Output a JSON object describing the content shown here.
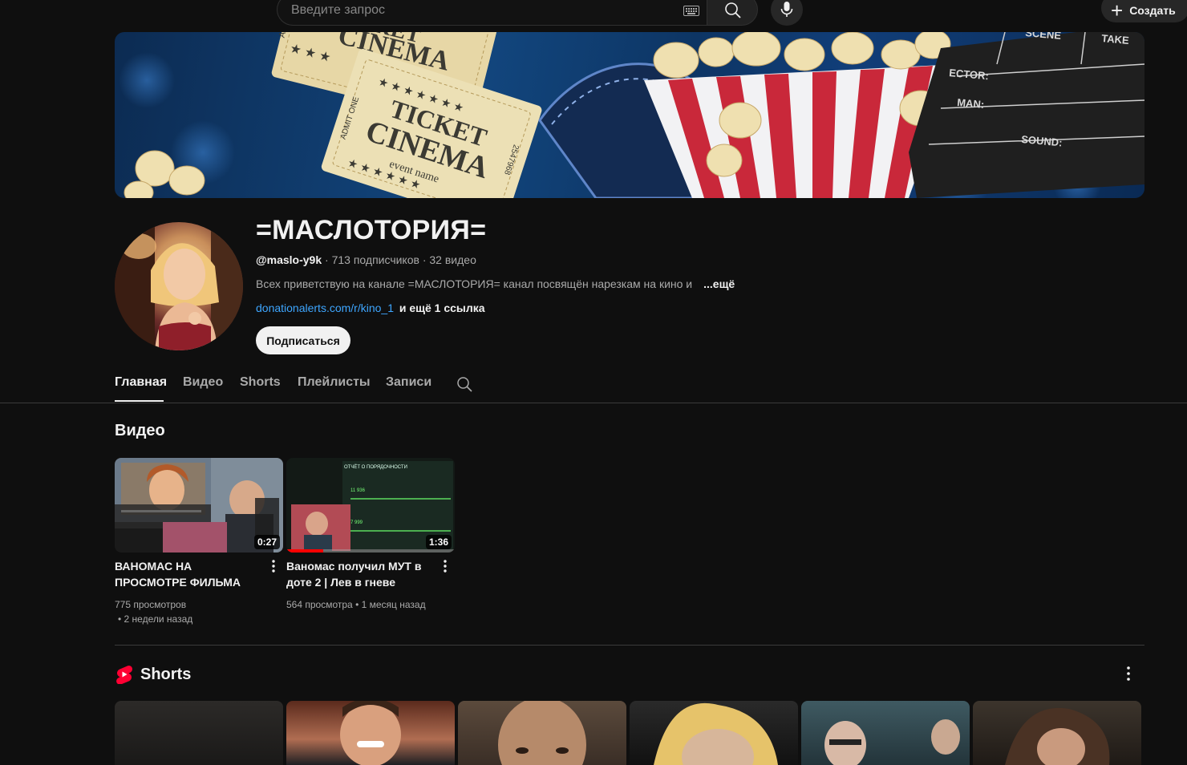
{
  "search": {
    "placeholder": "Введите запрос"
  },
  "header": {
    "create_label": "Создать"
  },
  "channel": {
    "name": "=МАСЛОТОРИЯ=",
    "handle": "@maslo-y9k",
    "subscribers": "713 подписчиков",
    "videos_count": "32 видео",
    "separator": " · ",
    "description": "Всех приветствую на канале =МАСЛОТОРИЯ= канал посвящён нарезкам на кино и",
    "more_label": "...ещё",
    "link": "donationalerts.com/r/kino_1",
    "more_links": "и ещё 1 ссылка",
    "subscribe_label": "Подписаться"
  },
  "banner": {
    "ticket_text_1": "TICKET",
    "ticket_text_2": "CINEMA",
    "ticket_text_3": "event name",
    "ticket_text_4": "ADMIT ONE",
    "ticket_number": "2547968",
    "ticket_number_2": "47968",
    "ticket_stars": "★ ★ ★",
    "ticket_stars_2": "★ ★ ★ ★ ★ ★ ★",
    "ticket_stars_3": "★ ★ ★ ★ ★ ★",
    "ticket_admit_short": "ADMI",
    "clapper_take": "TAKE",
    "clapper_scene": "SCENE",
    "clapper_director": "ECTOR:",
    "clapper_cameraman": "MAN:",
    "clapper_sound": "SOUND:"
  },
  "tabs": [
    {
      "label": "Главная",
      "active": true
    },
    {
      "label": "Видео",
      "active": false
    },
    {
      "label": "Shorts",
      "active": false
    },
    {
      "label": "Плейлисты",
      "active": false
    },
    {
      "label": "Записи",
      "active": false
    }
  ],
  "videos_section": {
    "title": "Видео",
    "items": [
      {
        "title": "ВАНОМАС НА ПРОСМОТРЕ ФИЛЬМА",
        "duration": "0:27",
        "views": "775 просмотров",
        "age": "• 2 недели назад",
        "progress": 0
      },
      {
        "title": "Ваномас получил МУТ в доте 2 | Лев в гневе",
        "duration": "1:36",
        "views": "564 просмотра",
        "age": "• 1 месяц назад",
        "progress": 0.22
      }
    ]
  },
  "thumb2_text": {
    "header": "ОТЧЁТ О ПОРЯДОЧНОСТИ",
    "value_1": "11 936",
    "value_2": "7 999"
  },
  "shorts_section": {
    "title": "Shorts"
  },
  "colors": {
    "accent_link": "#3ea6ff",
    "shorts_red": "#ff0033",
    "background": "#0f0f0f"
  }
}
